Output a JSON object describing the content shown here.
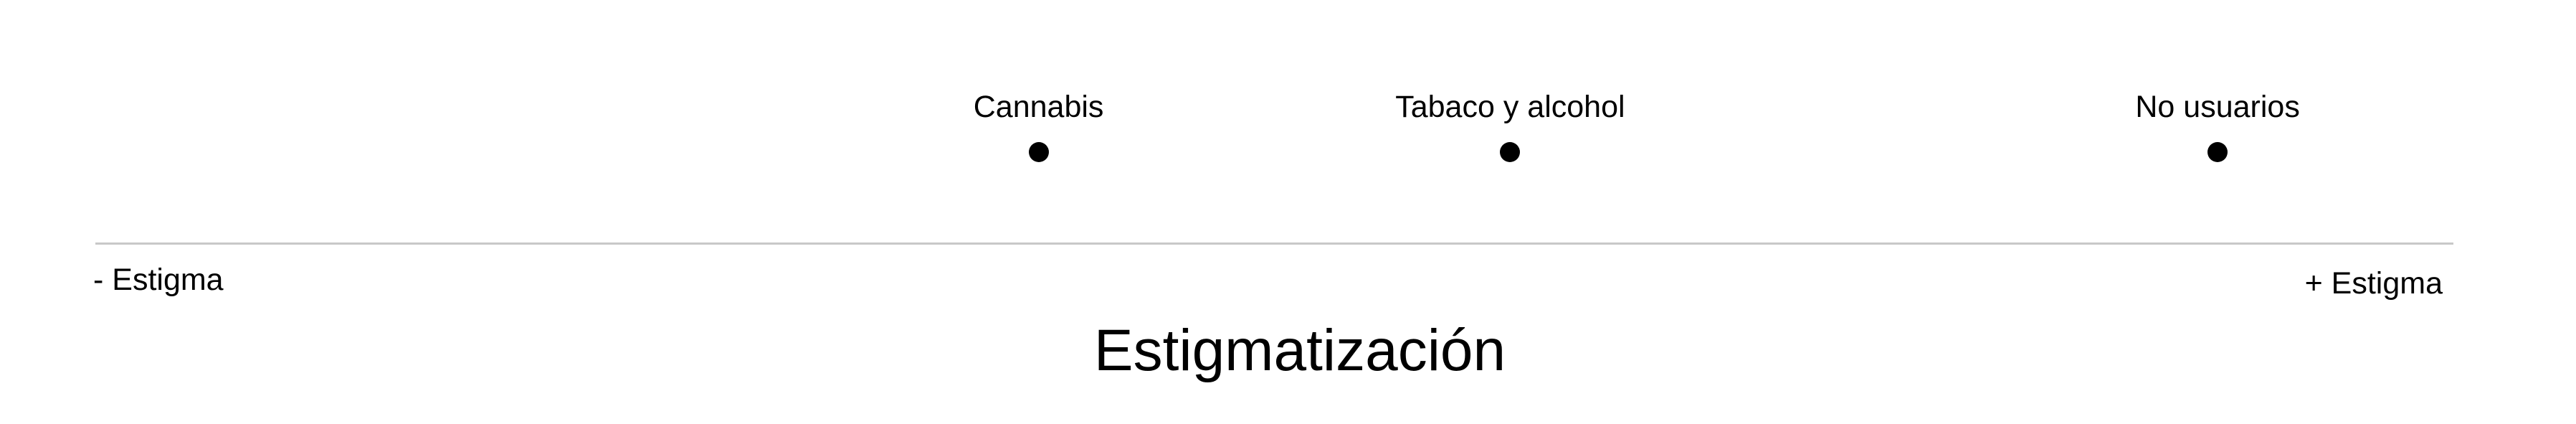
{
  "scale": {
    "title": "Estigmatización",
    "low_label": "- Estigma",
    "high_label": "+ Estigma"
  },
  "points": [
    {
      "label": "Cannabis",
      "level": 0.4
    },
    {
      "label": "Tabaco y alcohol",
      "level": 0.6
    },
    {
      "label": "No usuarios",
      "level": 0.9
    }
  ],
  "colors": {
    "dot": "#000000",
    "axis": "#c8c8c8",
    "text": "#000000"
  }
}
